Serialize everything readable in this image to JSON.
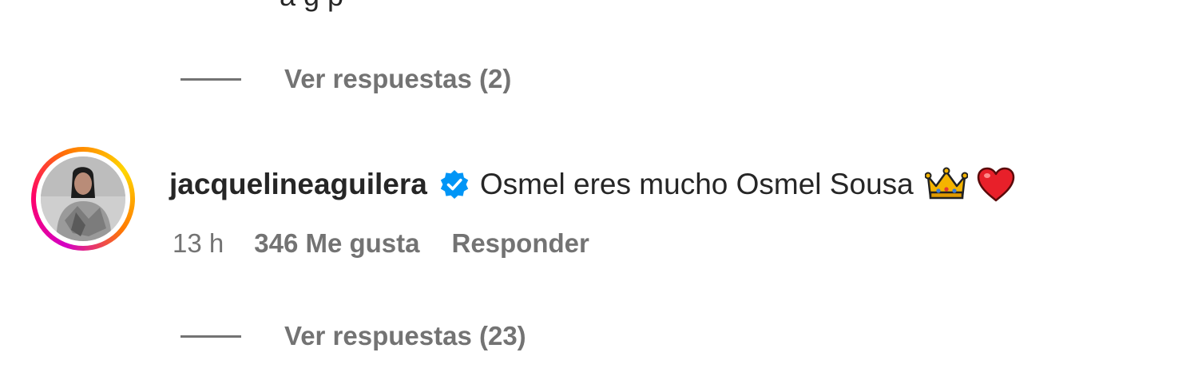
{
  "top_partial_text": "a  g        p",
  "thread_1": {
    "view_replies_label": "Ver respuestas (2)"
  },
  "comment": {
    "username": "jacquelineaguilera",
    "verified_icon": "verified-badge-icon",
    "text": "Osmel eres mucho Osmel Sousa",
    "emojis": [
      "crown-emoji",
      "red-heart-emoji"
    ],
    "time": "13 h",
    "likes": "346 Me gusta",
    "reply_label": "Responder",
    "view_replies_label": "Ver respuestas (23)"
  },
  "colors": {
    "primary_text": "#262626",
    "secondary_text": "#737373",
    "verified_blue": "#0095f6",
    "heart_red": "#e8202a",
    "crown_gold": "#f5b400"
  }
}
